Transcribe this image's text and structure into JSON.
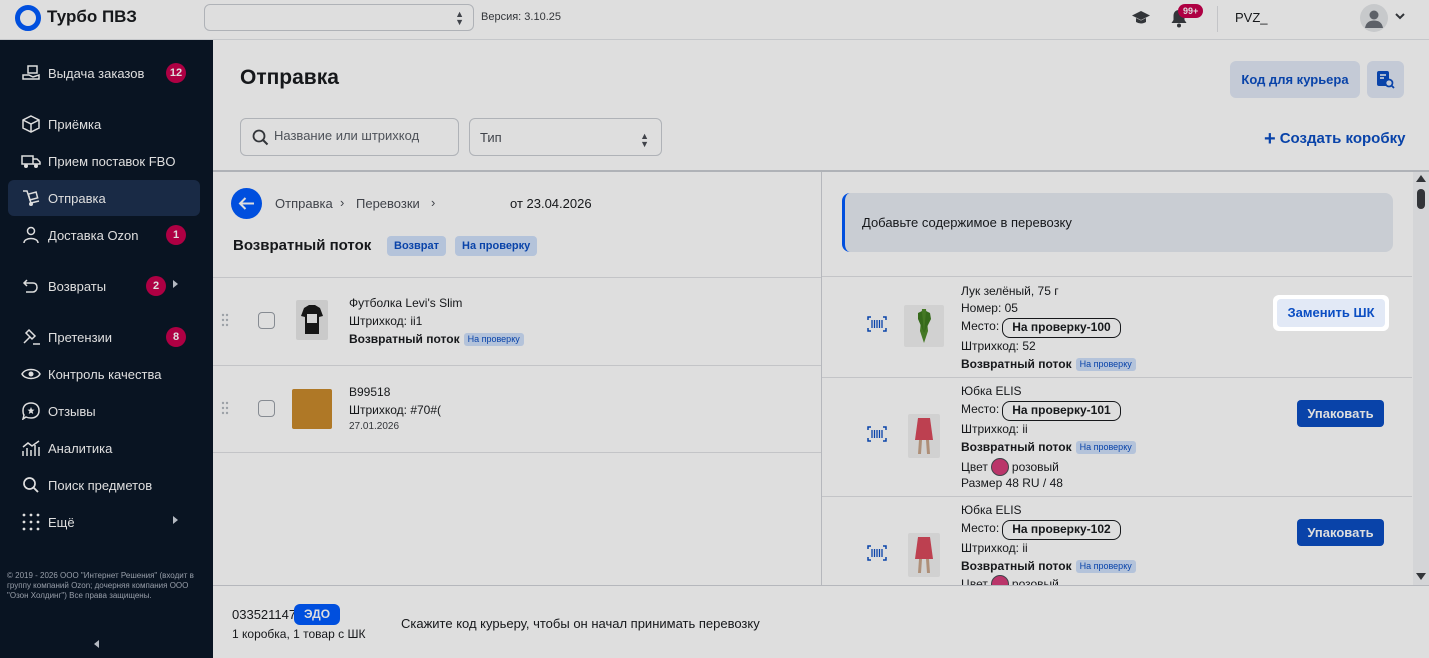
{
  "app": {
    "title": "Турбо ПВЗ",
    "version": "Версия: 3.10.25",
    "pvz_select_value": "",
    "notifications_badge": "99+",
    "pvz_name": "PVZ_"
  },
  "sidebar": {
    "items": [
      {
        "label": "Выдача заказов",
        "badge": "12",
        "icon": "hand-package-icon"
      },
      {
        "label": "Приёмка",
        "icon": "box-icon"
      },
      {
        "label": "Прием поставок FBO",
        "icon": "truck-icon"
      },
      {
        "label": "Отправка",
        "icon": "dolly-icon",
        "active": true
      },
      {
        "label": "Доставка Ozon",
        "badge": "1",
        "icon": "person-icon"
      },
      {
        "label": "Возвраты",
        "badge": "2",
        "icon": "return-icon",
        "has_submenu": true
      },
      {
        "label": "Претензии",
        "badge": "8",
        "icon": "hammer-icon"
      },
      {
        "label": "Контроль качества",
        "icon": "eye-icon"
      },
      {
        "label": "Отзывы",
        "icon": "star-bubble-icon"
      },
      {
        "label": "Аналитика",
        "icon": "chart-icon"
      },
      {
        "label": "Поиск предметов",
        "icon": "search-icon"
      },
      {
        "label": "Ещё",
        "icon": "grid-dots-icon",
        "has_submenu": true
      }
    ],
    "copyright": "© 2019 - 2026 ООО \"Интернет Решения\" (входит в группу компаний Ozon; дочерняя компания ООО \"Озон Холдинг\") Все права защищены."
  },
  "header": {
    "title": "Отправка",
    "courier_code_label": "Код для курьера",
    "search_placeholder": "Название или штрихкод",
    "type_select_label": "Тип",
    "create_box_label": "Создать коробку"
  },
  "shipment": {
    "breadcrumb": [
      "Отправка",
      "Перевозки"
    ],
    "date": "от 23.04.2026",
    "title": "Возвратный поток",
    "tags": [
      "Возврат",
      "На проверку"
    ]
  },
  "left_items": [
    {
      "name": "Футболка Levi's Slim",
      "barcode": "Штрихкод: ii1",
      "flow": "Возвратный поток",
      "tag": "На проверку"
    },
    {
      "name": "B99518",
      "barcode": "Штрихкод: #70#(",
      "date": "27.01.2026"
    }
  ],
  "right_panel": {
    "banner": "Добавьте содержимое в перевозку",
    "items": [
      {
        "name": "Лук зелёный, 75 г",
        "number": "Номер: 05",
        "place_label": "Место:",
        "place": "На проверку-100",
        "barcode": "Штрихкод: 52",
        "flow": "Возвратный поток",
        "tag": "На проверку",
        "action": "Заменить ШК"
      },
      {
        "name": "Юбка ELIS",
        "place_label": "Место:",
        "place": "На проверку-101",
        "barcode": "Штрихкод: ii",
        "flow": "Возвратный поток",
        "tag": "На проверку",
        "color_label": "Цвет",
        "color": "розовый",
        "size": "Размер 48 RU / 48",
        "action": "Упаковать"
      },
      {
        "name": "Юбка ELIS",
        "place_label": "Место:",
        "place": "На проверку-102",
        "barcode": "Штрихкод: ii",
        "flow": "Возвратный поток",
        "tag": "На проверку",
        "color_label": "Цвет",
        "color": "розовый",
        "action": "Упаковать"
      }
    ]
  },
  "bottom": {
    "code": "033521147",
    "edo": "ЭДО",
    "count": "1 коробка, 1 товар с ШК",
    "hint": "Скажите код курьеру, чтобы он начал принимать перевозку"
  },
  "colors": {
    "accent": "#005bff",
    "sidebar_bg": "#0b1728",
    "badge": "#c8004e",
    "button_primary": "#0b4ec3"
  }
}
